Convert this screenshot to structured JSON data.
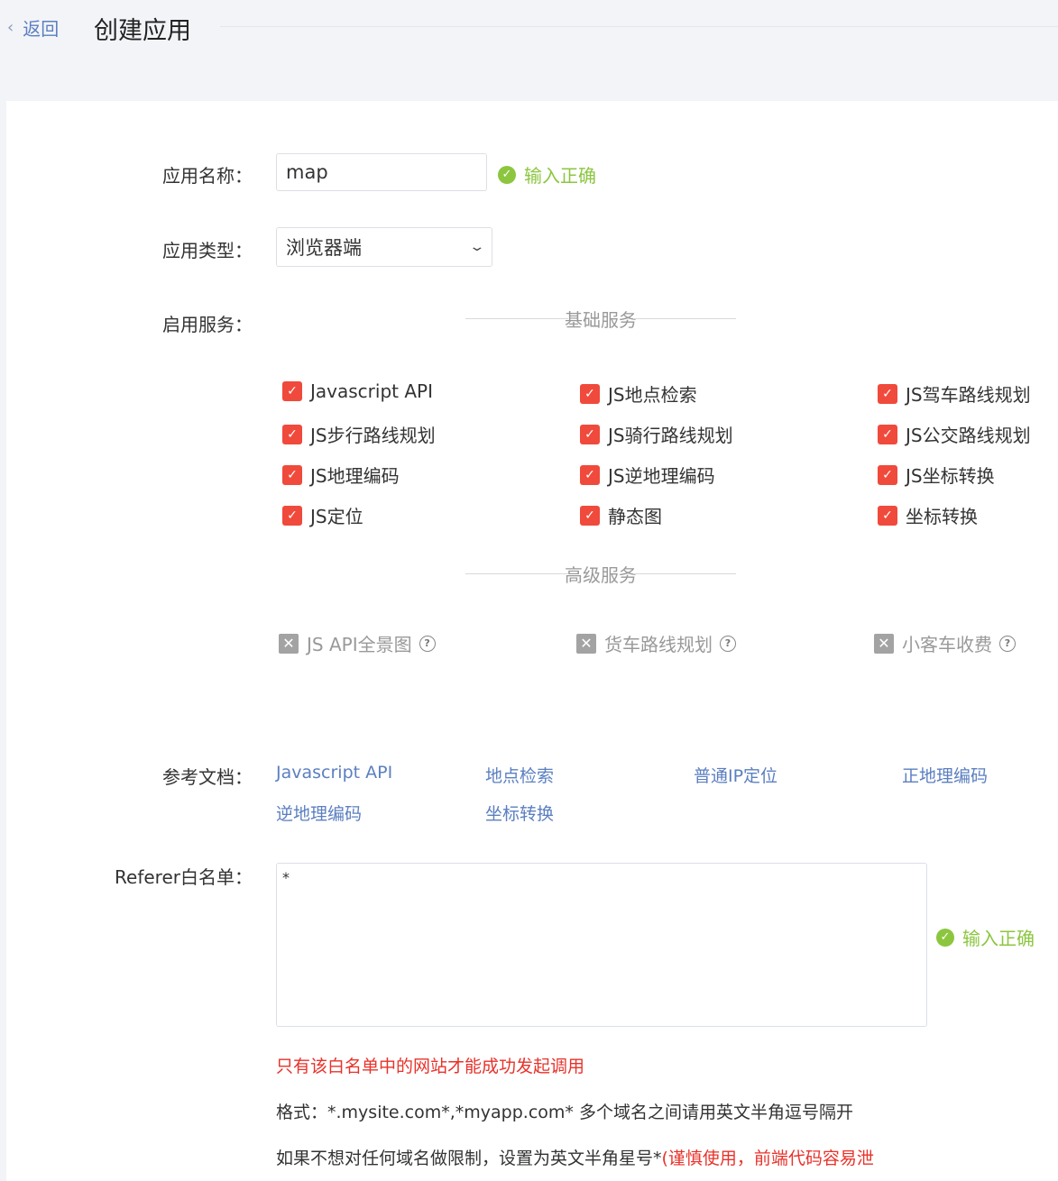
{
  "header": {
    "back_label": "返回",
    "title": "创建应用"
  },
  "form": {
    "app_name": {
      "label": "应用名称：",
      "value": "map",
      "status": "输入正确"
    },
    "app_type": {
      "label": "应用类型：",
      "value": "浏览器端"
    },
    "services": {
      "label": "启用服务：",
      "basic_title": "基础服务",
      "basic_items": [
        "Javascript API",
        "JS地点检索",
        "JS驾车路线规划",
        "JS步行路线规划",
        "JS骑行路线规划",
        "JS公交路线规划",
        "JS地理编码",
        "JS逆地理编码",
        "JS坐标转换",
        "JS定位",
        "静态图",
        "坐标转换"
      ],
      "advanced_title": "高级服务",
      "advanced_items": [
        "JS API全景图",
        "货车路线规划",
        "小客车收费"
      ]
    },
    "docs": {
      "label": "参考文档：",
      "links": [
        "Javascript API",
        "地点检索",
        "普通IP定位",
        "正地理编码",
        "逆地理编码",
        "坐标转换"
      ]
    },
    "referer": {
      "label": "Referer白名单：",
      "value": "*",
      "status": "输入正确",
      "note_red": "只有该白名单中的网站才能成功发起调用",
      "format_note": "格式：*.mysite.com*,*myapp.com* 多个域名之间请用英文半角逗号隔开",
      "wildcard_note": "如果不想对任何域名做限制，设置为英文半角星号*",
      "wildcard_warning": "(谨慎使用，前端代码容易泄"
    }
  },
  "colors": {
    "accent_link": "#5b7fc0",
    "success": "#8cc63f",
    "checkbox": "#f04a3c",
    "warning": "#e8322a"
  }
}
